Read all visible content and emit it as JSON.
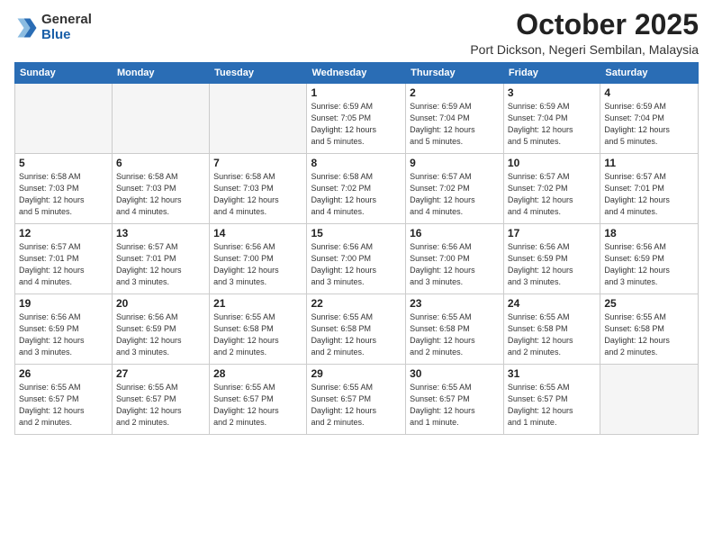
{
  "logo": {
    "general": "General",
    "blue": "Blue"
  },
  "title": "October 2025",
  "location": "Port Dickson, Negeri Sembilan, Malaysia",
  "weekdays": [
    "Sunday",
    "Monday",
    "Tuesday",
    "Wednesday",
    "Thursday",
    "Friday",
    "Saturday"
  ],
  "weeks": [
    [
      {
        "day": "",
        "info": ""
      },
      {
        "day": "",
        "info": ""
      },
      {
        "day": "",
        "info": ""
      },
      {
        "day": "1",
        "info": "Sunrise: 6:59 AM\nSunset: 7:05 PM\nDaylight: 12 hours\nand 5 minutes."
      },
      {
        "day": "2",
        "info": "Sunrise: 6:59 AM\nSunset: 7:04 PM\nDaylight: 12 hours\nand 5 minutes."
      },
      {
        "day": "3",
        "info": "Sunrise: 6:59 AM\nSunset: 7:04 PM\nDaylight: 12 hours\nand 5 minutes."
      },
      {
        "day": "4",
        "info": "Sunrise: 6:59 AM\nSunset: 7:04 PM\nDaylight: 12 hours\nand 5 minutes."
      }
    ],
    [
      {
        "day": "5",
        "info": "Sunrise: 6:58 AM\nSunset: 7:03 PM\nDaylight: 12 hours\nand 5 minutes."
      },
      {
        "day": "6",
        "info": "Sunrise: 6:58 AM\nSunset: 7:03 PM\nDaylight: 12 hours\nand 4 minutes."
      },
      {
        "day": "7",
        "info": "Sunrise: 6:58 AM\nSunset: 7:03 PM\nDaylight: 12 hours\nand 4 minutes."
      },
      {
        "day": "8",
        "info": "Sunrise: 6:58 AM\nSunset: 7:02 PM\nDaylight: 12 hours\nand 4 minutes."
      },
      {
        "day": "9",
        "info": "Sunrise: 6:57 AM\nSunset: 7:02 PM\nDaylight: 12 hours\nand 4 minutes."
      },
      {
        "day": "10",
        "info": "Sunrise: 6:57 AM\nSunset: 7:02 PM\nDaylight: 12 hours\nand 4 minutes."
      },
      {
        "day": "11",
        "info": "Sunrise: 6:57 AM\nSunset: 7:01 PM\nDaylight: 12 hours\nand 4 minutes."
      }
    ],
    [
      {
        "day": "12",
        "info": "Sunrise: 6:57 AM\nSunset: 7:01 PM\nDaylight: 12 hours\nand 4 minutes."
      },
      {
        "day": "13",
        "info": "Sunrise: 6:57 AM\nSunset: 7:01 PM\nDaylight: 12 hours\nand 3 minutes."
      },
      {
        "day": "14",
        "info": "Sunrise: 6:56 AM\nSunset: 7:00 PM\nDaylight: 12 hours\nand 3 minutes."
      },
      {
        "day": "15",
        "info": "Sunrise: 6:56 AM\nSunset: 7:00 PM\nDaylight: 12 hours\nand 3 minutes."
      },
      {
        "day": "16",
        "info": "Sunrise: 6:56 AM\nSunset: 7:00 PM\nDaylight: 12 hours\nand 3 minutes."
      },
      {
        "day": "17",
        "info": "Sunrise: 6:56 AM\nSunset: 6:59 PM\nDaylight: 12 hours\nand 3 minutes."
      },
      {
        "day": "18",
        "info": "Sunrise: 6:56 AM\nSunset: 6:59 PM\nDaylight: 12 hours\nand 3 minutes."
      }
    ],
    [
      {
        "day": "19",
        "info": "Sunrise: 6:56 AM\nSunset: 6:59 PM\nDaylight: 12 hours\nand 3 minutes."
      },
      {
        "day": "20",
        "info": "Sunrise: 6:56 AM\nSunset: 6:59 PM\nDaylight: 12 hours\nand 3 minutes."
      },
      {
        "day": "21",
        "info": "Sunrise: 6:55 AM\nSunset: 6:58 PM\nDaylight: 12 hours\nand 2 minutes."
      },
      {
        "day": "22",
        "info": "Sunrise: 6:55 AM\nSunset: 6:58 PM\nDaylight: 12 hours\nand 2 minutes."
      },
      {
        "day": "23",
        "info": "Sunrise: 6:55 AM\nSunset: 6:58 PM\nDaylight: 12 hours\nand 2 minutes."
      },
      {
        "day": "24",
        "info": "Sunrise: 6:55 AM\nSunset: 6:58 PM\nDaylight: 12 hours\nand 2 minutes."
      },
      {
        "day": "25",
        "info": "Sunrise: 6:55 AM\nSunset: 6:58 PM\nDaylight: 12 hours\nand 2 minutes."
      }
    ],
    [
      {
        "day": "26",
        "info": "Sunrise: 6:55 AM\nSunset: 6:57 PM\nDaylight: 12 hours\nand 2 minutes."
      },
      {
        "day": "27",
        "info": "Sunrise: 6:55 AM\nSunset: 6:57 PM\nDaylight: 12 hours\nand 2 minutes."
      },
      {
        "day": "28",
        "info": "Sunrise: 6:55 AM\nSunset: 6:57 PM\nDaylight: 12 hours\nand 2 minutes."
      },
      {
        "day": "29",
        "info": "Sunrise: 6:55 AM\nSunset: 6:57 PM\nDaylight: 12 hours\nand 2 minutes."
      },
      {
        "day": "30",
        "info": "Sunrise: 6:55 AM\nSunset: 6:57 PM\nDaylight: 12 hours\nand 1 minute."
      },
      {
        "day": "31",
        "info": "Sunrise: 6:55 AM\nSunset: 6:57 PM\nDaylight: 12 hours\nand 1 minute."
      },
      {
        "day": "",
        "info": ""
      }
    ]
  ]
}
